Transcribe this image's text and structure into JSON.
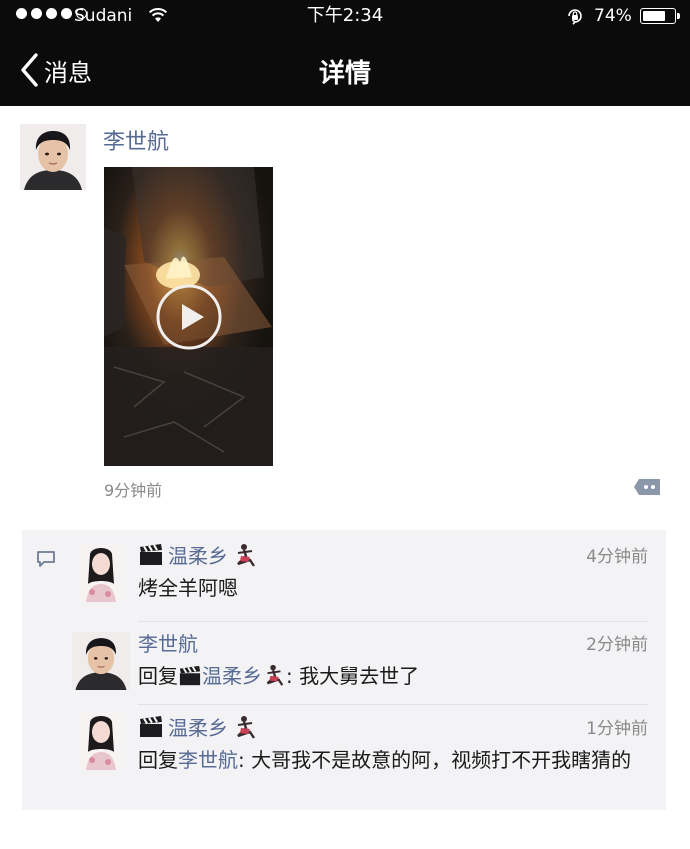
{
  "status_bar": {
    "carrier": "Sudani",
    "time": "下午2:34",
    "battery_percent": "74%",
    "battery_level": 0.74,
    "signal_bars_filled": 4,
    "signal_bars_total": 5
  },
  "nav": {
    "back_label": "消息",
    "title": "详情"
  },
  "post": {
    "author": "李世航",
    "time": "9分钟前",
    "media": "video"
  },
  "comments": [
    {
      "author": "温柔乡",
      "time": "4分钟前",
      "text": "烤全羊阿嗯"
    },
    {
      "author": "李世航",
      "time": "2分钟前",
      "reply_prefix": "回复",
      "reply_to": "温柔乡",
      "text": ": 我大舅去世了"
    },
    {
      "author": "温柔乡",
      "time": "1分钟前",
      "reply_prefix": "回复",
      "reply_to": "李世航",
      "text": ": 大哥我不是故意的阿，视频打不开我瞎猜的"
    }
  ],
  "colors": {
    "nav_background": "#0b0b0b",
    "link_blue": "#576b95",
    "comment_panel": "#f3f3f5",
    "secondary_text": "#8a8a8a"
  }
}
